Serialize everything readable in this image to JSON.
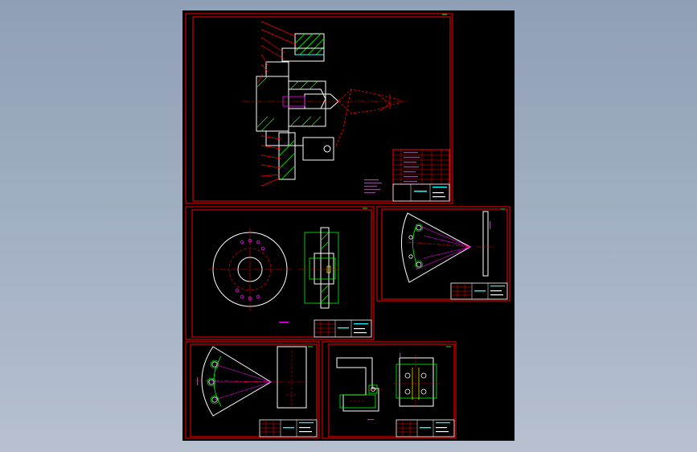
{
  "viewer": {
    "background_top": "#8f9fb6",
    "background_bottom": "#b6c0cf",
    "canvas_color": "#000000"
  },
  "colors": {
    "frame": "#ff0000",
    "outline": "#ffffff",
    "centerline": "#ff0000",
    "hatch": "#00ff00",
    "dimension": "#ff00ff",
    "accent": "#00ffff",
    "construction": "#ffff00"
  },
  "sheets": [
    {
      "name": "assembly-drawing"
    },
    {
      "name": "base-plate-drawing"
    },
    {
      "name": "sector-plate-drawing"
    },
    {
      "name": "sector-part-drawing"
    },
    {
      "name": "bracket-drawing"
    }
  ]
}
